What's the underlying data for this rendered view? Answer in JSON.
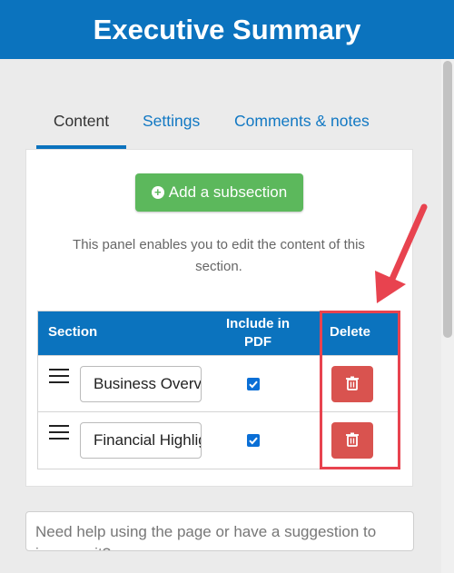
{
  "header": {
    "title": "Executive Summary"
  },
  "tabs": [
    {
      "label": "Content",
      "active": true
    },
    {
      "label": "Settings",
      "active": false
    },
    {
      "label": "Comments & notes",
      "active": false
    }
  ],
  "panel": {
    "add_button_label": "Add a subsection",
    "description": "This panel enables you to edit the content of this section."
  },
  "table": {
    "headers": {
      "section": "Section",
      "include_line1": "Include in",
      "include_line2": "PDF",
      "delete": "Delete"
    },
    "rows": [
      {
        "name": "Business Overview",
        "include": true
      },
      {
        "name": "Financial Highlights",
        "include": true
      }
    ]
  },
  "help": {
    "placeholder": "Need help using the page or have a suggestion to improve it?"
  },
  "colors": {
    "header_bg": "#0b73be",
    "add_button": "#5cb85c",
    "delete_button": "#d9534f",
    "annotation": "#e8434f",
    "link": "#1178c3"
  },
  "icons": {
    "drag": "hamburger-icon",
    "delete": "trash-icon",
    "add": "plus-circle-icon"
  }
}
